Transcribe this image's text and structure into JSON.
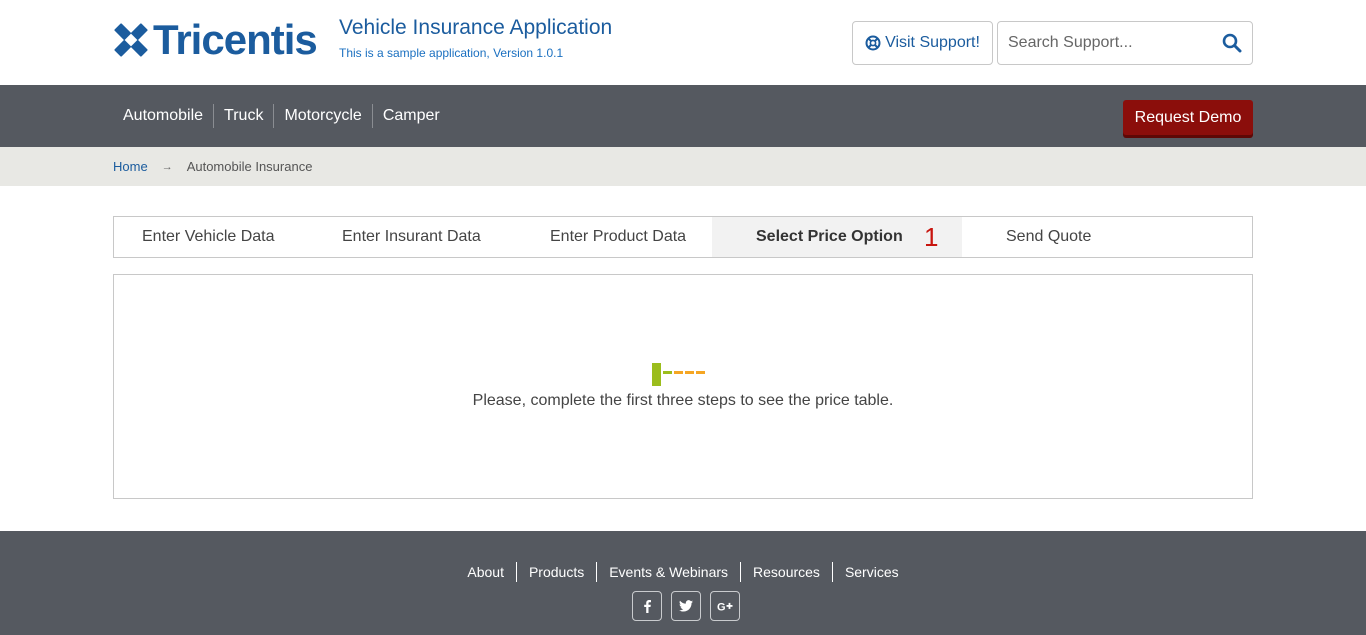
{
  "header": {
    "logo_text": "Tricentis",
    "app_title": "Vehicle Insurance Application",
    "app_subtitle": "This is a sample application, Version 1.0.1",
    "support_label": "Visit Support!",
    "search_placeholder": "Search Support...",
    "support_icon": "lifebuoy-icon",
    "search_icon": "search-icon"
  },
  "nav": {
    "items": [
      {
        "label": "Automobile"
      },
      {
        "label": "Truck"
      },
      {
        "label": "Motorcycle"
      },
      {
        "label": "Camper"
      }
    ],
    "demo_label": "Request Demo"
  },
  "breadcrumb": {
    "home": "Home",
    "arrow": "→",
    "current": "Automobile Insurance"
  },
  "steps": {
    "items": [
      {
        "label": "Enter Vehicle Data"
      },
      {
        "label": "Enter Insurant Data"
      },
      {
        "label": "Enter Product Data"
      },
      {
        "label": "Select Price Option",
        "active": true,
        "count": "1"
      },
      {
        "label": "Send Quote"
      }
    ]
  },
  "content": {
    "message": "Please, complete the first three steps to see the price table."
  },
  "footer": {
    "links": [
      {
        "label": "About"
      },
      {
        "label": "Products"
      },
      {
        "label": "Events & Webinars"
      },
      {
        "label": "Resources"
      },
      {
        "label": "Services"
      }
    ],
    "social": [
      {
        "icon": "facebook-icon",
        "glyph": "f"
      },
      {
        "icon": "twitter-icon",
        "glyph": "t"
      },
      {
        "icon": "google-plus-icon",
        "glyph": "G+"
      }
    ]
  },
  "colors": {
    "brand_blue": "#1b5c9e",
    "nav_gray": "#555960",
    "demo_red": "#8b0e0b",
    "step_count_red": "#c8150f",
    "loader_green": "#9bbd1c",
    "loader_orange": "#f5a623"
  }
}
